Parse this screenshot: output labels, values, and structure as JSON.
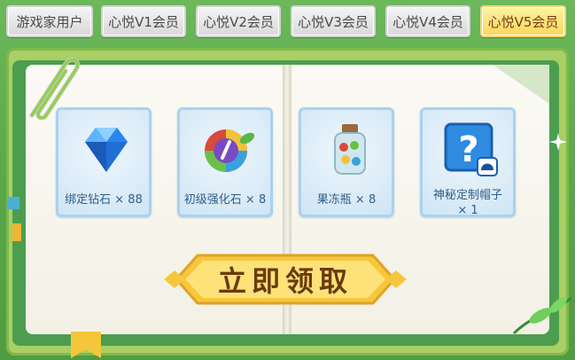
{
  "tabs": [
    {
      "label": "游戏家用户",
      "active": false
    },
    {
      "label": "心悦V1会员",
      "active": false
    },
    {
      "label": "心悦V2会员",
      "active": false
    },
    {
      "label": "心悦V3会员",
      "active": false
    },
    {
      "label": "心悦V4会员",
      "active": false
    },
    {
      "label": "心悦V5会员",
      "active": true
    }
  ],
  "rewards": [
    {
      "label": "绑定钻石 × 88",
      "icon": "diamond-icon"
    },
    {
      "label": "初级强化石 × 8",
      "icon": "enhance-stone-icon"
    },
    {
      "label": "果冻瓶 × 8",
      "icon": "jelly-jar-icon"
    },
    {
      "label": "神秘定制帽子 × 1",
      "line1": "神秘定制帽子",
      "line2": "× 1",
      "icon": "mystery-hat-icon"
    }
  ],
  "claim_button": {
    "label": "立即领取"
  },
  "colors": {
    "tab_active": "#fad75a",
    "tab_inactive": "#d9d9d9",
    "frame_green": "#4c9e4e",
    "card_border": "#a8d2f2",
    "button_gold": "#f9d75a"
  }
}
